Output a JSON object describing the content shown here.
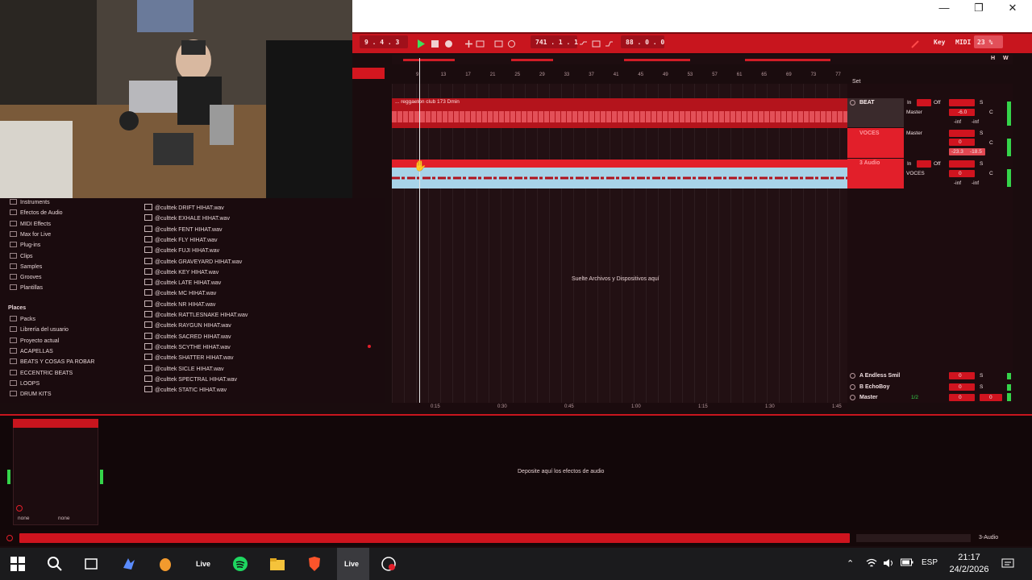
{
  "window": {
    "minimize": "—",
    "restore": "❐",
    "close": "✕"
  },
  "control_bar": {
    "position": "9 .  4 .  3",
    "loop_start": "741 .  1 .  1",
    "loop_length": "88 .  0 .  0",
    "key_label": "Key",
    "midi_label": "MIDI",
    "cpu": "23 %"
  },
  "ruler": [
    "9",
    "13",
    "17",
    "21",
    "25",
    "29",
    "33",
    "37",
    "41",
    "45",
    "49",
    "53",
    "57",
    "61",
    "65",
    "69",
    "73",
    "77"
  ],
  "set_label": "Set",
  "hw": {
    "h": "H",
    "w": "W"
  },
  "tracks": [
    {
      "name": "BEAT",
      "input": "In",
      "auto": "Off",
      "output": "Master",
      "volume": "-6.0",
      "pan": "C",
      "peak_a": "-inf",
      "peak_b": "-inf",
      "solo": "S",
      "color": "#c8151e"
    },
    {
      "name": "VOCES",
      "output": "Master",
      "volume": "0",
      "pan": "C",
      "peak_a": "-23.3",
      "peak_b": "-18.5",
      "solo": "S",
      "color": "#e21f2a"
    },
    {
      "name": "3 Audio",
      "input": "In",
      "auto": "Off",
      "output": "VOCES",
      "volume": "0",
      "pan": "C",
      "peak_a": "-inf",
      "peak_b": "-inf",
      "solo": "S",
      "color": "#e21f2a"
    }
  ],
  "beat_clip_title": "... reggaeton club 173 Dmin",
  "drop_files_msg": "Suelte Archivos y Dispositivos aquí",
  "returns": [
    {
      "name": "A Endless Smil",
      "volume": "0",
      "solo": "S"
    },
    {
      "name": "B EchoBoy",
      "volume": "0",
      "solo": "S"
    },
    {
      "name": "Master",
      "routing": "1/2",
      "volume": "0",
      "pan": "0"
    }
  ],
  "timeline": [
    "0:15",
    "0:30",
    "0:45",
    "1:00",
    "1:15",
    "1:30",
    "1:45"
  ],
  "browser": {
    "categories": [
      "Instruments",
      "Efectos de Audio",
      "MIDI Effects",
      "Max for Live",
      "Plug-ins",
      "Clips",
      "Samples",
      "Grooves",
      "Plantillas"
    ],
    "places_title": "Places",
    "places": [
      "Packs",
      "Librería del usuario",
      "Proyecto actual",
      "ACAPELLAS",
      "BEATS Y COSAS PA ROBAR",
      "ECCENTRIC BEATS",
      "LOOPS",
      "DRUM KITS"
    ],
    "files": [
      "@culttek DRIFT HIHAT.wav",
      "@culttek EXHALE HIHAT.wav",
      "@culttek FENT HIHAT.wav",
      "@culttek FLY HIHAT.wav",
      "@culttek FUJI HIHAT.wav",
      "@culttek GRAVEYARD HIHAT.wav",
      "@culttek KEY HIHAT.wav",
      "@culttek LATE HIHAT.wav",
      "@culttek MC HIHAT.wav",
      "@culttek NR HIHAT.wav",
      "@culttek RATTLESNAKE HIHAT.wav",
      "@culttek RAYGUN HIHAT.wav",
      "@culttek SACRED HIHAT.wav",
      "@culttek SCYTHE HIHAT.wav",
      "@culttek SHATTER HIHAT.wav",
      "@culttek SICLE HIHAT.wav",
      "@culttek SPECTRAL HIHAT.wav",
      "@culttek STATIC HIHAT.wav"
    ]
  },
  "device": {
    "drop_fx_msg": "Deposite aquí los efectos de audio",
    "none_left": "none",
    "none_right": "none"
  },
  "status": {
    "right_label": "3-Audio"
  },
  "taskbar": {
    "lang": "ESP",
    "time": "21:17",
    "date": "24/2/2026",
    "live_label": "Live"
  },
  "colors": {
    "accent": "#c8151e",
    "audio_clip": "#a8d3e8",
    "meter": "#35d44a"
  }
}
